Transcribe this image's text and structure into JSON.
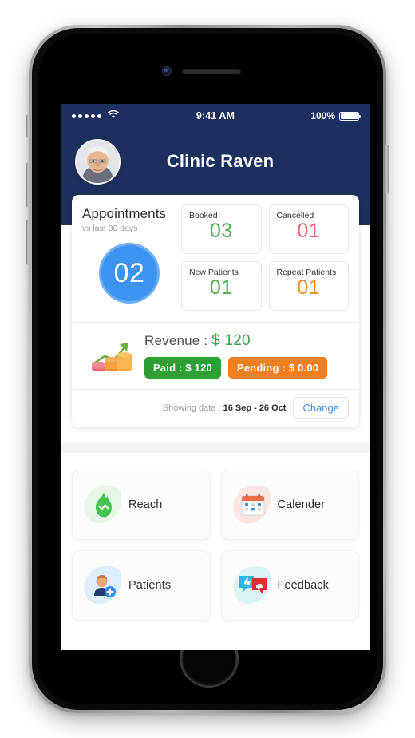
{
  "statusbar": {
    "signal_icon": "signal-dots-icon",
    "wifi_icon": "wifi-icon",
    "time": "9:41 AM",
    "battery_percent": "100%",
    "battery_icon": "battery-full-icon"
  },
  "header": {
    "avatar_icon": "user-avatar-photo",
    "title": "Clinic Raven",
    "background_color": "#1d2f5e"
  },
  "appointments": {
    "title": "Appointments",
    "subtitle": "vs last 30 days",
    "total_badge": "02",
    "badge_color": "#3d94f0",
    "stats": [
      {
        "label": "Booked",
        "value": "03",
        "color": "#4caf50"
      },
      {
        "label": "Cancelled",
        "value": "01",
        "color": "#f4616a"
      },
      {
        "label": "New Patients",
        "value": "01",
        "color": "#4caf50"
      },
      {
        "label": "Repeat Patients",
        "value": "01",
        "color": "#ef8b22"
      }
    ]
  },
  "revenue": {
    "icon": "revenue-growth-chart-icon",
    "label": "Revenue :",
    "amount": "$ 120",
    "amount_color": "#37a24a",
    "paid_badge": "Paid : $ 120",
    "paid_color": "#2e9e35",
    "pending_badge": "Pending : $ 0.00",
    "pending_color": "#ef7f1f"
  },
  "date_filter": {
    "prefix": "Showing date :",
    "range": "16 Sep - 26 Oct",
    "change_label": "Change",
    "change_color": "#3b8cf0"
  },
  "menu": {
    "items": [
      {
        "label": "Reach",
        "icon": "flame-reach-icon",
        "blob_color": "#e7f6e7"
      },
      {
        "label": "Calender",
        "icon": "calendar-icon",
        "blob_color": "#fbe6e1"
      },
      {
        "label": "Patients",
        "icon": "add-patient-icon",
        "blob_color": "#ddeefc"
      },
      {
        "label": "Feedback",
        "icon": "feedback-chat-icon",
        "blob_color": "#dbf4f6"
      }
    ]
  },
  "device": {
    "camera_icon": "front-camera-icon",
    "speaker_icon": "earpiece-speaker-icon",
    "home_button_icon": "home-button-icon"
  }
}
